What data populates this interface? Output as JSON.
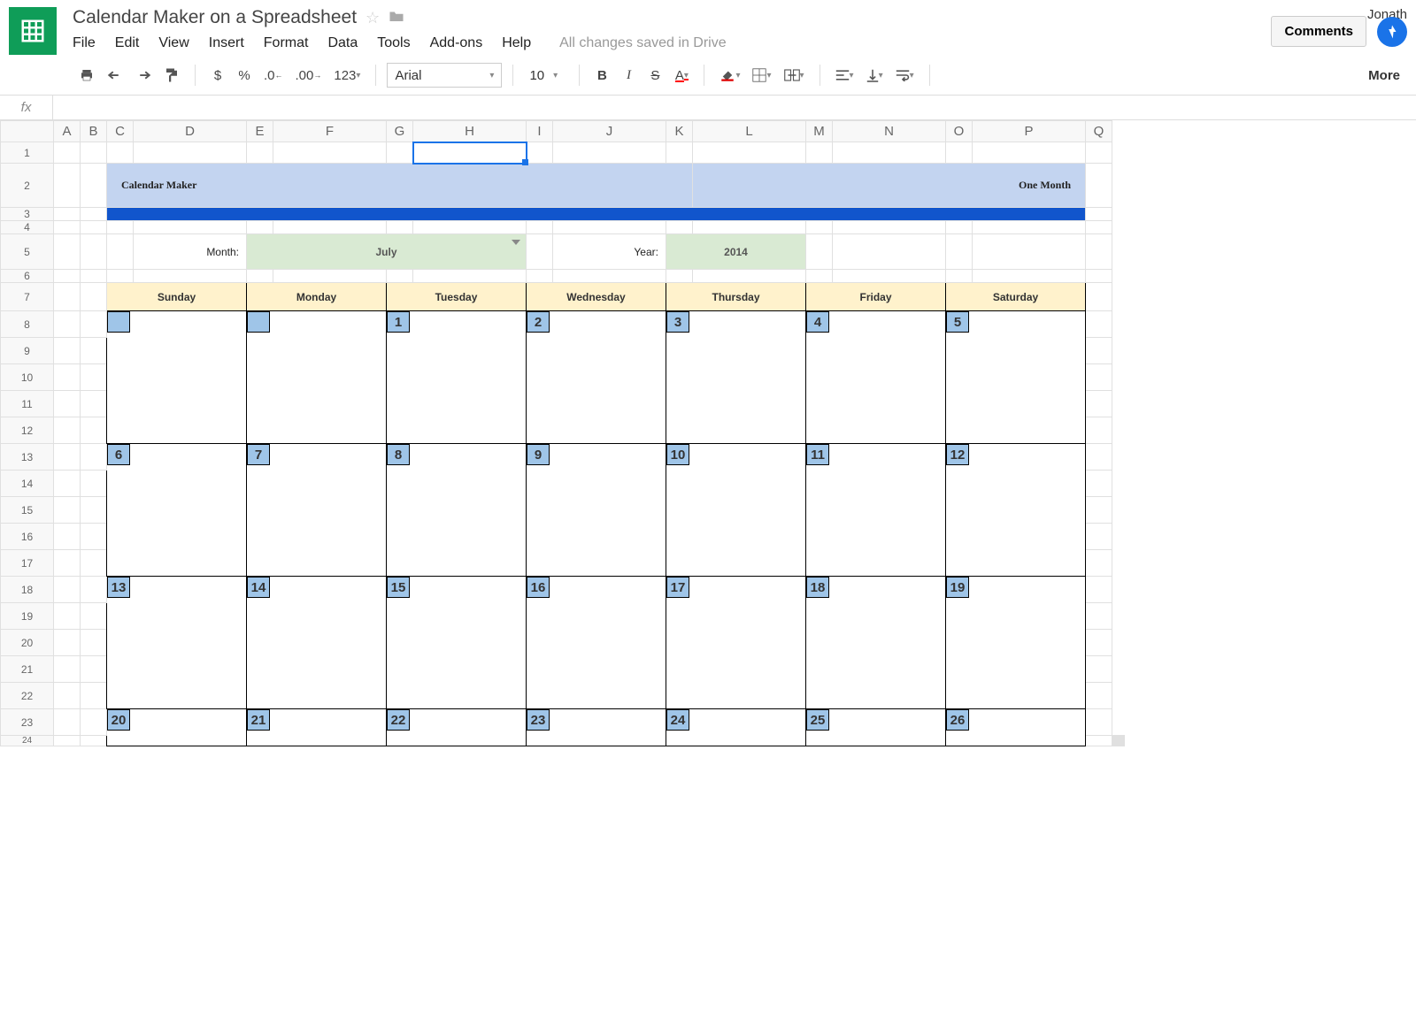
{
  "doc_title": "Calendar Maker on a Spreadsheet",
  "user_name": "Jonath",
  "comments_button": "Comments",
  "save_status": "All changes saved in Drive",
  "menus": [
    "File",
    "Edit",
    "View",
    "Insert",
    "Format",
    "Data",
    "Tools",
    "Add-ons",
    "Help"
  ],
  "toolbar": {
    "currency": "$",
    "percent": "%",
    "dec_dec": ".0",
    "dec_inc": ".00",
    "format": "123",
    "font": "Arial",
    "size": "10",
    "bold": "B",
    "italic": "I",
    "strike": "S",
    "underline": "A",
    "more": "More"
  },
  "fx_label": "fx",
  "columns": [
    "A",
    "B",
    "C",
    "D",
    "E",
    "F",
    "G",
    "H",
    "I",
    "J",
    "K",
    "L",
    "M",
    "N",
    "O",
    "P",
    "Q"
  ],
  "row_numbers": [
    1,
    2,
    3,
    4,
    5,
    6,
    7,
    8,
    9,
    10,
    11,
    12,
    13,
    14,
    15,
    16,
    17,
    18,
    19,
    20,
    21,
    22,
    23,
    24
  ],
  "banner_left": "Calendar Maker",
  "banner_right": "One Month",
  "month_label": "Month:",
  "month_value": "July",
  "year_label": "Year:",
  "year_value": "2014",
  "days": [
    "Sunday",
    "Monday",
    "Tuesday",
    "Wednesday",
    "Thursday",
    "Friday",
    "Saturday"
  ],
  "calendar": [
    [
      "",
      "",
      "1",
      "2",
      "3",
      "4",
      "5"
    ],
    [
      "6",
      "7",
      "8",
      "9",
      "10",
      "11",
      "12"
    ],
    [
      "13",
      "14",
      "15",
      "16",
      "17",
      "18",
      "19"
    ],
    [
      "20",
      "21",
      "22",
      "23",
      "24",
      "25",
      "26"
    ]
  ],
  "selected_cell": "H1"
}
